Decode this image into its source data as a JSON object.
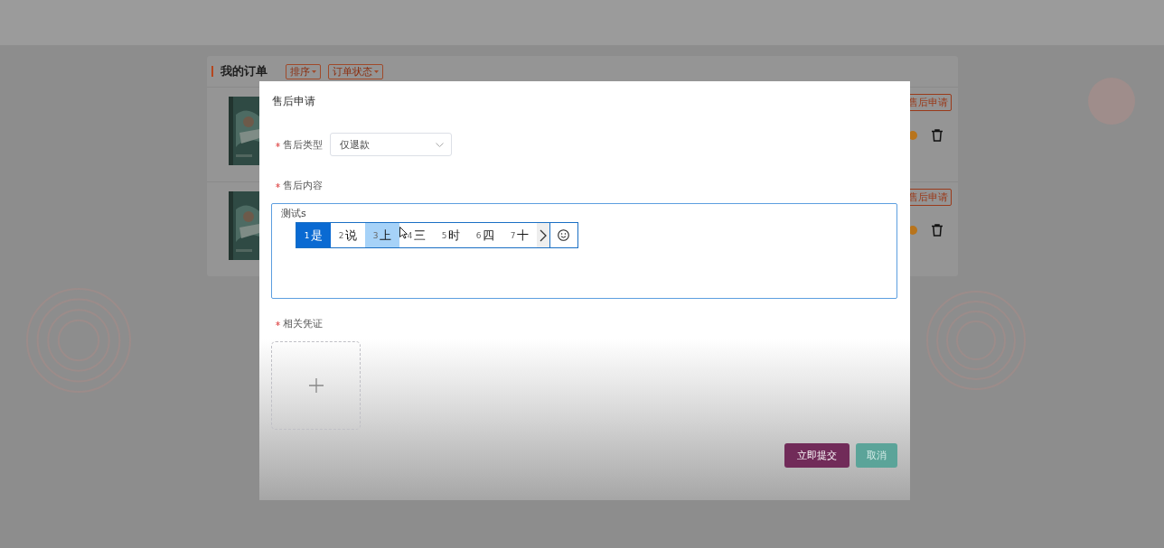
{
  "page": {
    "title": "我的订单",
    "filters": [
      "排序",
      "订单状态"
    ],
    "orders": [
      {
        "action": "售后申请"
      },
      {
        "action": "售后申请"
      }
    ]
  },
  "dialog": {
    "title": "售后申请",
    "fields": [
      {
        "kind": "select",
        "label": "售后类型",
        "required": true,
        "value": "仅退款"
      },
      {
        "kind": "textarea",
        "label": "售后内容",
        "required": true,
        "value": "测试s"
      },
      {
        "kind": "upload",
        "label": "相关凭证",
        "required": true
      }
    ],
    "ime": {
      "candidates": [
        {
          "index": "1",
          "text": "是",
          "selected": true,
          "hovered": false
        },
        {
          "index": "2",
          "text": "说",
          "selected": false,
          "hovered": false
        },
        {
          "index": "3",
          "text": "上",
          "selected": false,
          "hovered": true
        },
        {
          "index": "4",
          "text": "三",
          "selected": false,
          "hovered": false
        },
        {
          "index": "5",
          "text": "时",
          "selected": false,
          "hovered": false
        },
        {
          "index": "6",
          "text": "四",
          "selected": false,
          "hovered": false
        },
        {
          "index": "7",
          "text": "十",
          "selected": false,
          "hovered": false
        }
      ]
    },
    "buttons": [
      {
        "kind": "primary",
        "label": "立即提交"
      },
      {
        "kind": "secondary",
        "label": "取消"
      }
    ]
  }
}
